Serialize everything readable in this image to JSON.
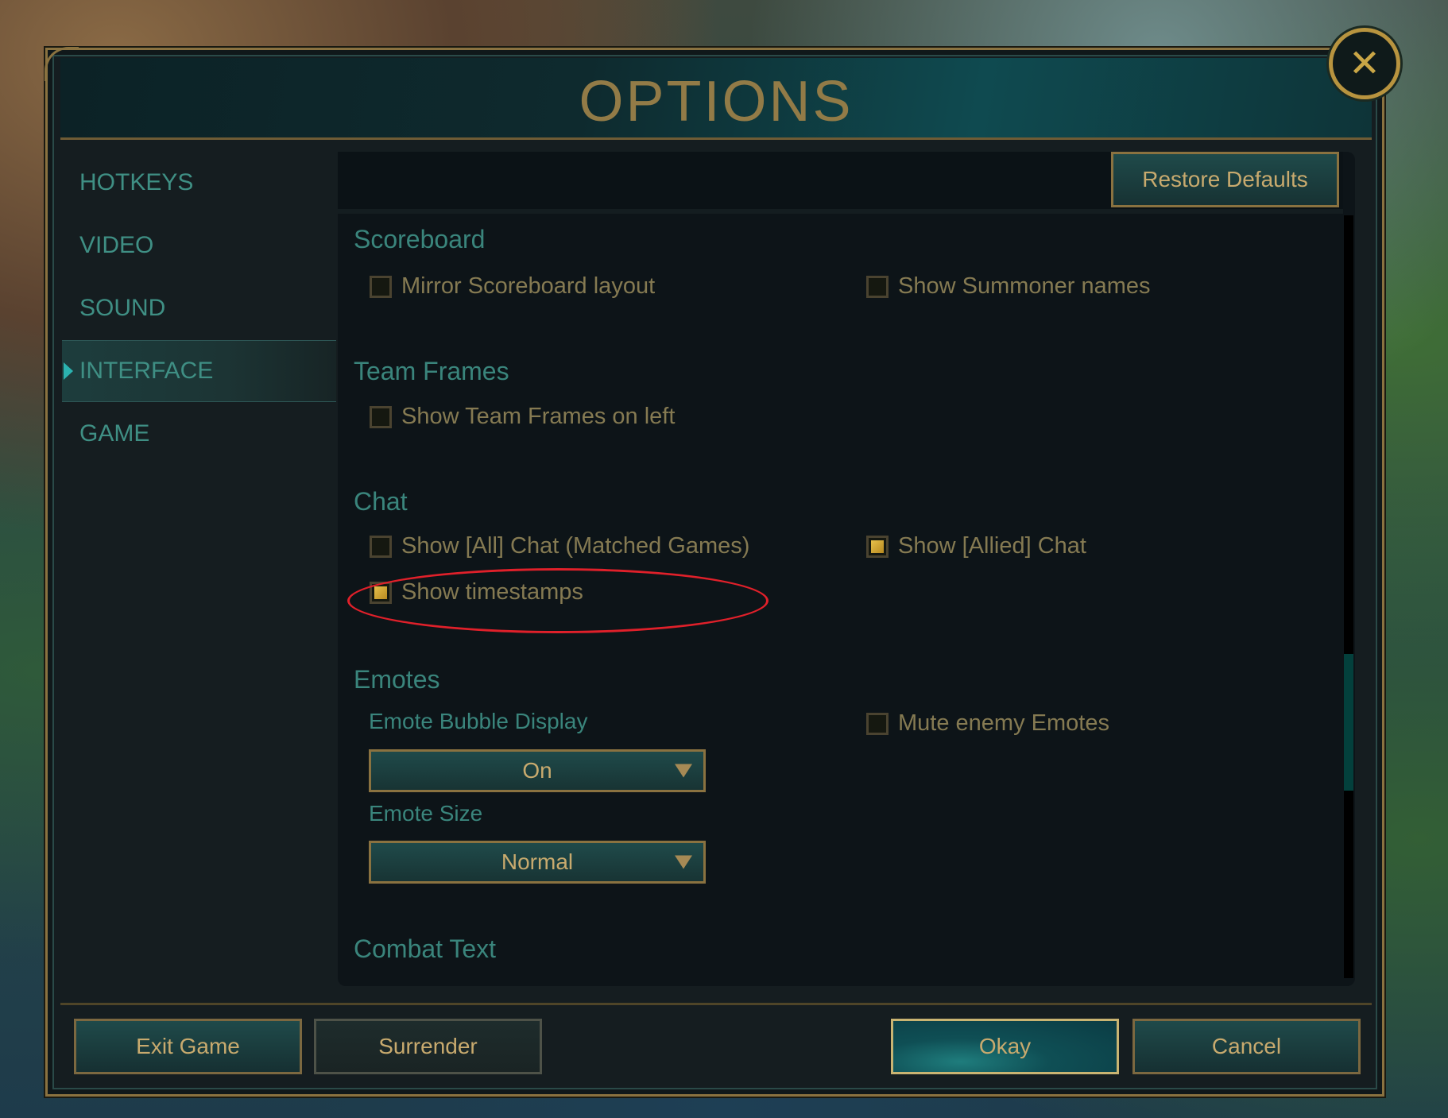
{
  "window": {
    "title": "OPTIONS",
    "close_icon": "close-icon"
  },
  "sidebar": {
    "items": [
      {
        "label": "HOTKEYS",
        "active": false
      },
      {
        "label": "VIDEO",
        "active": false
      },
      {
        "label": "SOUND",
        "active": false
      },
      {
        "label": "INTERFACE",
        "active": true
      },
      {
        "label": "GAME",
        "active": false
      }
    ]
  },
  "toolbar": {
    "restore_defaults_label": "Restore Defaults"
  },
  "sections": {
    "scoreboard": {
      "title": "Scoreboard",
      "options": [
        {
          "label": "Mirror Scoreboard layout",
          "checked": false
        },
        {
          "label": "Show Summoner names",
          "checked": false
        }
      ]
    },
    "team_frames": {
      "title": "Team Frames",
      "options": [
        {
          "label": "Show Team Frames on left",
          "checked": false
        }
      ]
    },
    "chat": {
      "title": "Chat",
      "options": [
        {
          "label": "Show [All] Chat (Matched Games)",
          "checked": false,
          "annotated": true
        },
        {
          "label": "Show [Allied] Chat",
          "checked": true
        },
        {
          "label": "Show timestamps",
          "checked": true
        }
      ]
    },
    "emotes": {
      "title": "Emotes",
      "bubble_display_label": "Emote Bubble Display",
      "bubble_display_value": "On",
      "size_label": "Emote Size",
      "size_value": "Normal",
      "options": [
        {
          "label": "Mute enemy Emotes",
          "checked": false
        }
      ]
    },
    "combat_text": {
      "title": "Combat Text"
    }
  },
  "footer": {
    "exit_label": "Exit Game",
    "surrender_label": "Surrender",
    "okay_label": "Okay",
    "cancel_label": "Cancel"
  },
  "scroll": {
    "position_fraction": 0.7
  },
  "colors": {
    "accent_gold": "#c8aa6e",
    "title_gold": "#927b47",
    "section_teal": "#3a857c",
    "annotation_red": "#e0202a"
  }
}
